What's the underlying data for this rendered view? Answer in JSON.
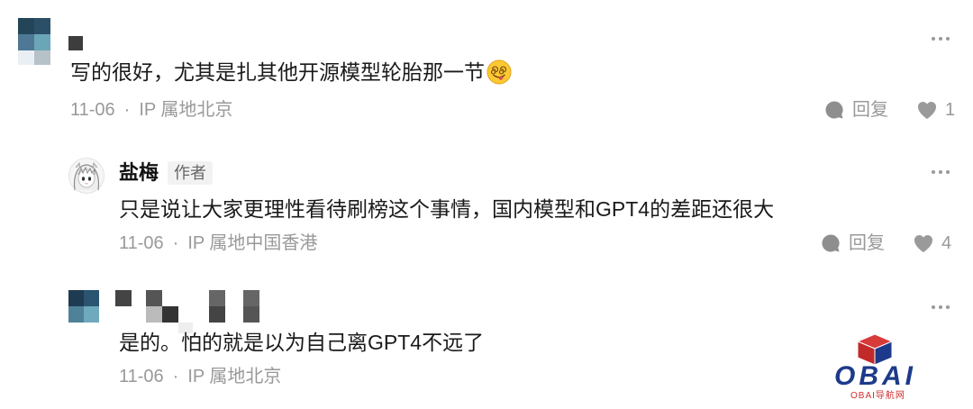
{
  "comments": [
    {
      "text": "写的很好，尤其是扎其他开源模型轮胎那一节",
      "emoji_icon": "yummy-face-emoji",
      "date": "11-06",
      "separator": "·",
      "location": "IP 属地北京",
      "reply_label": "回复",
      "like_count": "1"
    },
    {
      "author_name": "盐梅",
      "author_badge": "作者",
      "text": "只是说让大家更理性看待刷榜这个事情，国内模型和GPT4的差距还很大",
      "date": "11-06",
      "separator": "·",
      "location": "IP 属地中国香港",
      "reply_label": "回复",
      "like_count": "4"
    },
    {
      "text": "是的。怕的就是以为自己离GPT4不远了",
      "date": "11-06",
      "separator": "·",
      "location": "IP 属地北京"
    }
  ],
  "watermark": {
    "logo_text": "OBAI",
    "tagline": "OBAI导航网"
  },
  "icons": {
    "more": "more-icon",
    "reply": "reply-icon",
    "like": "heart-icon",
    "watermark_logo": "cube-logo-icon"
  },
  "colors": {
    "text": "#1a1a1a",
    "meta": "#999999",
    "badge_bg": "#f2f2f2",
    "watermark_blue": "#1d3a8a",
    "watermark_red": "#d12e2e"
  }
}
